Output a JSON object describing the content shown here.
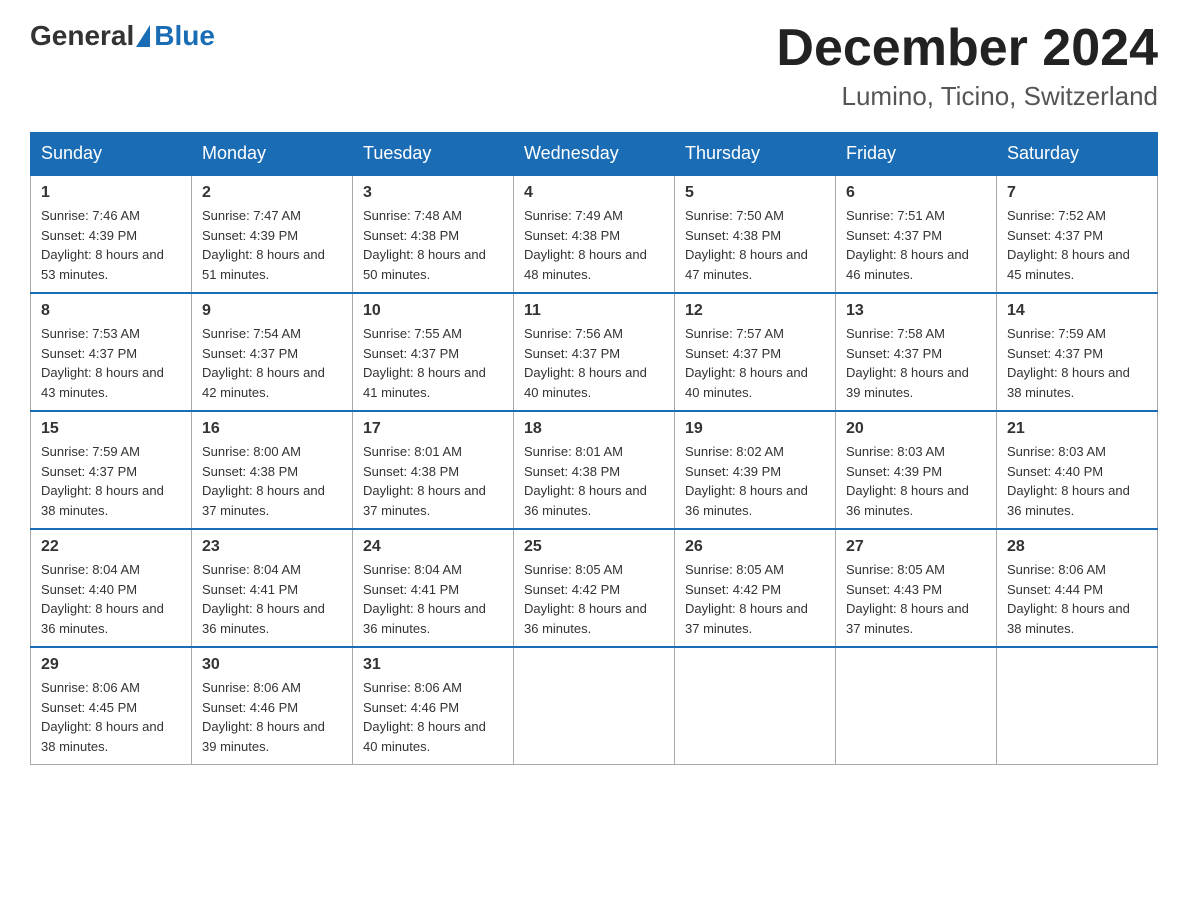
{
  "header": {
    "logo_general": "General",
    "logo_blue": "Blue",
    "month_title": "December 2024",
    "location": "Lumino, Ticino, Switzerland"
  },
  "days_of_week": [
    "Sunday",
    "Monday",
    "Tuesday",
    "Wednesday",
    "Thursday",
    "Friday",
    "Saturday"
  ],
  "weeks": [
    [
      {
        "num": "1",
        "sunrise": "7:46 AM",
        "sunset": "4:39 PM",
        "daylight": "8 hours and 53 minutes."
      },
      {
        "num": "2",
        "sunrise": "7:47 AM",
        "sunset": "4:39 PM",
        "daylight": "8 hours and 51 minutes."
      },
      {
        "num": "3",
        "sunrise": "7:48 AM",
        "sunset": "4:38 PM",
        "daylight": "8 hours and 50 minutes."
      },
      {
        "num": "4",
        "sunrise": "7:49 AM",
        "sunset": "4:38 PM",
        "daylight": "8 hours and 48 minutes."
      },
      {
        "num": "5",
        "sunrise": "7:50 AM",
        "sunset": "4:38 PM",
        "daylight": "8 hours and 47 minutes."
      },
      {
        "num": "6",
        "sunrise": "7:51 AM",
        "sunset": "4:37 PM",
        "daylight": "8 hours and 46 minutes."
      },
      {
        "num": "7",
        "sunrise": "7:52 AM",
        "sunset": "4:37 PM",
        "daylight": "8 hours and 45 minutes."
      }
    ],
    [
      {
        "num": "8",
        "sunrise": "7:53 AM",
        "sunset": "4:37 PM",
        "daylight": "8 hours and 43 minutes."
      },
      {
        "num": "9",
        "sunrise": "7:54 AM",
        "sunset": "4:37 PM",
        "daylight": "8 hours and 42 minutes."
      },
      {
        "num": "10",
        "sunrise": "7:55 AM",
        "sunset": "4:37 PM",
        "daylight": "8 hours and 41 minutes."
      },
      {
        "num": "11",
        "sunrise": "7:56 AM",
        "sunset": "4:37 PM",
        "daylight": "8 hours and 40 minutes."
      },
      {
        "num": "12",
        "sunrise": "7:57 AM",
        "sunset": "4:37 PM",
        "daylight": "8 hours and 40 minutes."
      },
      {
        "num": "13",
        "sunrise": "7:58 AM",
        "sunset": "4:37 PM",
        "daylight": "8 hours and 39 minutes."
      },
      {
        "num": "14",
        "sunrise": "7:59 AM",
        "sunset": "4:37 PM",
        "daylight": "8 hours and 38 minutes."
      }
    ],
    [
      {
        "num": "15",
        "sunrise": "7:59 AM",
        "sunset": "4:37 PM",
        "daylight": "8 hours and 38 minutes."
      },
      {
        "num": "16",
        "sunrise": "8:00 AM",
        "sunset": "4:38 PM",
        "daylight": "8 hours and 37 minutes."
      },
      {
        "num": "17",
        "sunrise": "8:01 AM",
        "sunset": "4:38 PM",
        "daylight": "8 hours and 37 minutes."
      },
      {
        "num": "18",
        "sunrise": "8:01 AM",
        "sunset": "4:38 PM",
        "daylight": "8 hours and 36 minutes."
      },
      {
        "num": "19",
        "sunrise": "8:02 AM",
        "sunset": "4:39 PM",
        "daylight": "8 hours and 36 minutes."
      },
      {
        "num": "20",
        "sunrise": "8:03 AM",
        "sunset": "4:39 PM",
        "daylight": "8 hours and 36 minutes."
      },
      {
        "num": "21",
        "sunrise": "8:03 AM",
        "sunset": "4:40 PM",
        "daylight": "8 hours and 36 minutes."
      }
    ],
    [
      {
        "num": "22",
        "sunrise": "8:04 AM",
        "sunset": "4:40 PM",
        "daylight": "8 hours and 36 minutes."
      },
      {
        "num": "23",
        "sunrise": "8:04 AM",
        "sunset": "4:41 PM",
        "daylight": "8 hours and 36 minutes."
      },
      {
        "num": "24",
        "sunrise": "8:04 AM",
        "sunset": "4:41 PM",
        "daylight": "8 hours and 36 minutes."
      },
      {
        "num": "25",
        "sunrise": "8:05 AM",
        "sunset": "4:42 PM",
        "daylight": "8 hours and 36 minutes."
      },
      {
        "num": "26",
        "sunrise": "8:05 AM",
        "sunset": "4:42 PM",
        "daylight": "8 hours and 37 minutes."
      },
      {
        "num": "27",
        "sunrise": "8:05 AM",
        "sunset": "4:43 PM",
        "daylight": "8 hours and 37 minutes."
      },
      {
        "num": "28",
        "sunrise": "8:06 AM",
        "sunset": "4:44 PM",
        "daylight": "8 hours and 38 minutes."
      }
    ],
    [
      {
        "num": "29",
        "sunrise": "8:06 AM",
        "sunset": "4:45 PM",
        "daylight": "8 hours and 38 minutes."
      },
      {
        "num": "30",
        "sunrise": "8:06 AM",
        "sunset": "4:46 PM",
        "daylight": "8 hours and 39 minutes."
      },
      {
        "num": "31",
        "sunrise": "8:06 AM",
        "sunset": "4:46 PM",
        "daylight": "8 hours and 40 minutes."
      },
      null,
      null,
      null,
      null
    ]
  ]
}
